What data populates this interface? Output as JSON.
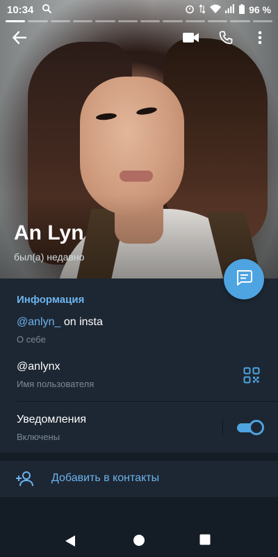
{
  "status_bar": {
    "time": "10:34",
    "battery": "96 %"
  },
  "contact": {
    "name": "An Lyn",
    "status": "был(а) недавно"
  },
  "info": {
    "section_title": "Информация",
    "bio_mention": "@anlyn_",
    "bio_rest": " on insta",
    "bio_label": "О себе",
    "username": "@anlynx",
    "username_label": "Имя пользователя",
    "notifications": "Уведомления",
    "notifications_state": "Включены",
    "notifications_on": true
  },
  "actions": {
    "add_contact": "Добавить в контакты"
  },
  "icons": {
    "back": "arrow-left-icon",
    "video": "video-call-icon",
    "call": "phone-icon",
    "more": "more-vertical-icon",
    "message": "message-icon",
    "qr": "qr-code-icon",
    "add_user": "add-user-icon"
  },
  "colors": {
    "accent": "#4ea4e0",
    "accent_text": "#6cb4ee",
    "panel": "#1d2733",
    "background": "#141c26"
  }
}
